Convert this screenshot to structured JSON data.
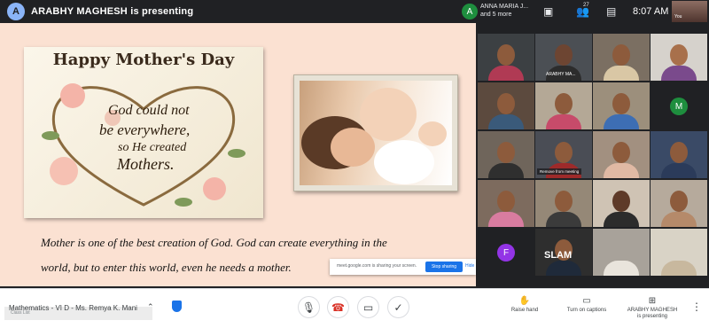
{
  "topbar": {
    "presenter_initial": "A",
    "presenting_text": "ARABHY MAGHESH is presenting",
    "self_initial": "A",
    "participant_name": "ANNA MARIA J...",
    "participant_more": "and 5 more",
    "people_count": "27",
    "time": "8:07 AM",
    "self_label": "You"
  },
  "slide": {
    "card_title": "Happy Mother's Day",
    "card_lines": [
      "God could not",
      "be everywhere,",
      "so He created",
      "Mothers."
    ],
    "quote_line1": "Mother is one of the best creation of God. God can create everything in the",
    "quote_line2": "world, but to enter this world, even he needs a mother."
  },
  "share_bar": {
    "text": "meet.google.com is sharing your screen.",
    "stop_label": "Stop sharing",
    "hide_label": "Hide"
  },
  "participants": {
    "tile_name_1": "ARABHY MA...",
    "tooltip": "Remove from meeting",
    "letter_m": "M",
    "letter_f": "F",
    "slam_text": "SLAM"
  },
  "bottombar": {
    "meeting_title": "Mathematics - VI D - Ms. Remya K. Mani",
    "class_list": "Class List",
    "raise_hand": "Raise hand",
    "captions": "Turn on captions",
    "presenting_line1": "ARABHY MAGHESH",
    "presenting_line2": "is presenting"
  },
  "colors": {
    "accent": "#1a73e8",
    "end_call": "#d93025",
    "avatar_m": "#1e8e3e",
    "avatar_f": "#9334e6"
  }
}
